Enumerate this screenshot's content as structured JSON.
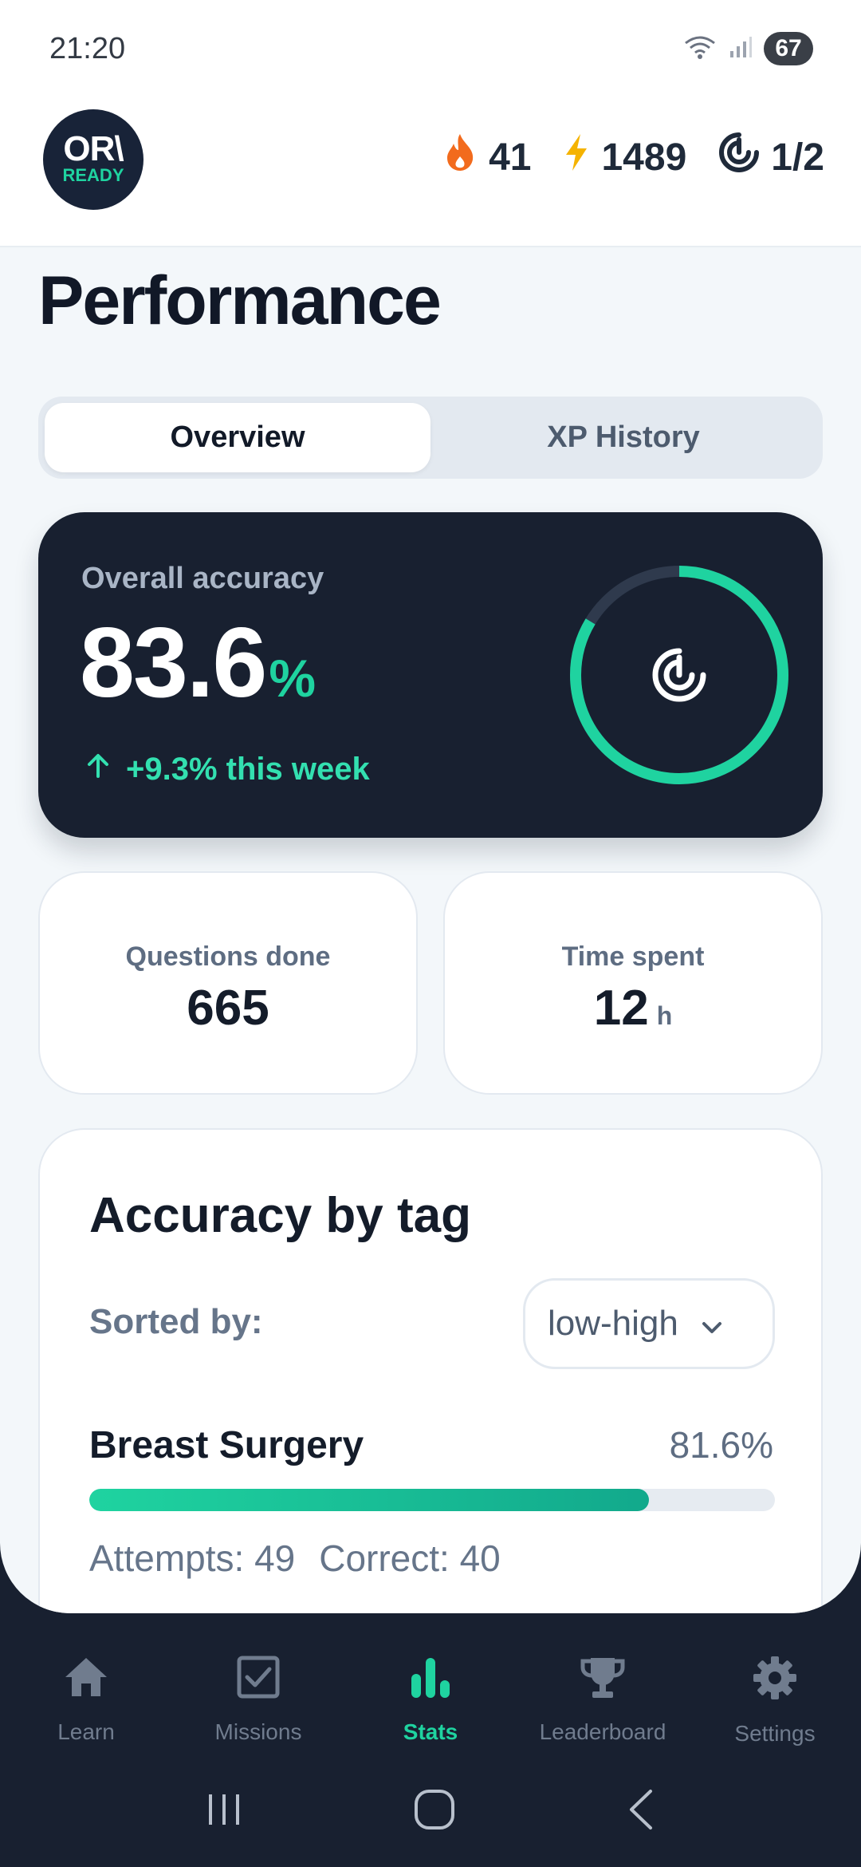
{
  "status_bar": {
    "time": "21:20",
    "battery": "67"
  },
  "header": {
    "logo_top": "OR\\",
    "logo_bottom": "READY",
    "streak": "41",
    "xp": "1489",
    "goal": "1/2"
  },
  "page": {
    "title": "Performance"
  },
  "tabs": [
    {
      "label": "Overview",
      "active": true
    },
    {
      "label": "XP History",
      "active": false
    }
  ],
  "accuracy": {
    "label": "Overall accuracy",
    "value": "83.6",
    "unit": "%",
    "change": "+9.3% this week",
    "ring_fraction": 0.836
  },
  "stats": {
    "questions_label": "Questions done",
    "questions_value": "665",
    "time_label": "Time spent",
    "time_value": "12",
    "time_unit": "h"
  },
  "tag_section": {
    "title": "Accuracy by tag",
    "sorted_label": "Sorted by:",
    "sort_value": "low-high",
    "items": [
      {
        "name": "Breast Surgery",
        "percent": "81.6%",
        "fraction": 0.816,
        "attempts": "Attempts: 49",
        "correct": "Correct: 40"
      }
    ]
  },
  "nav": [
    {
      "label": "Learn",
      "icon": "home-icon"
    },
    {
      "label": "Missions",
      "icon": "checkbox-icon"
    },
    {
      "label": "Stats",
      "icon": "bar-chart-icon",
      "active": true
    },
    {
      "label": "Leaderboard",
      "icon": "trophy-icon"
    },
    {
      "label": "Settings",
      "icon": "gear-icon"
    }
  ],
  "colors": {
    "accent": "#1fd3a0",
    "dark": "#182030",
    "streak": "#f26b1d",
    "xp": "#f5b300"
  }
}
